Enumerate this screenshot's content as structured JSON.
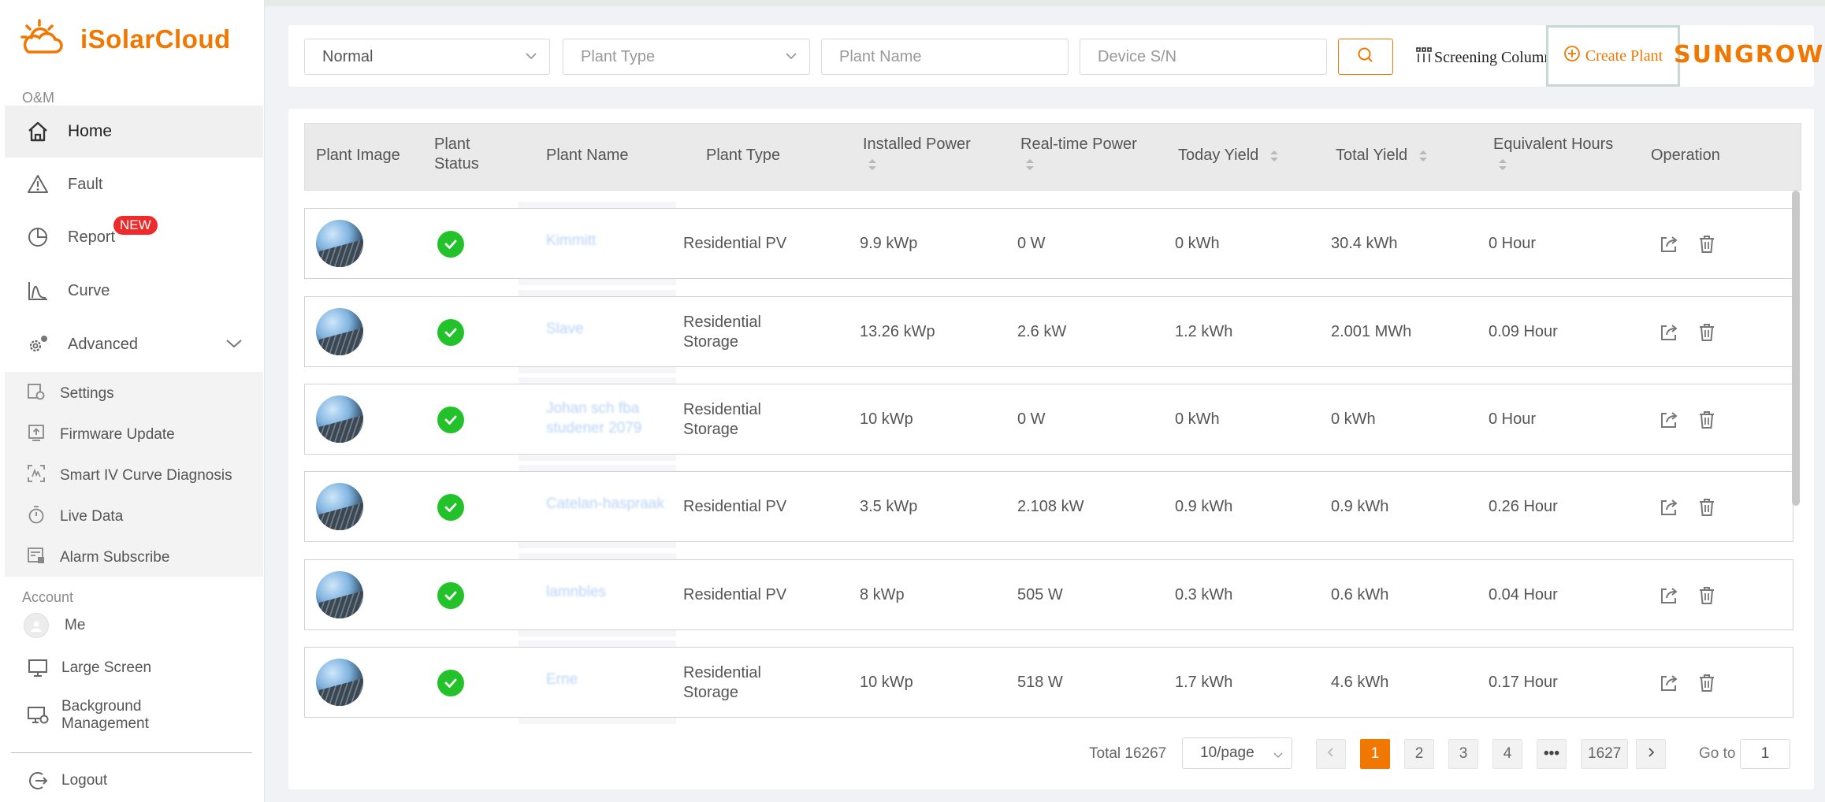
{
  "app": {
    "brand": "iSolarCloud",
    "partner_logo": "SUNGROW",
    "accent_color": "#f07800"
  },
  "sidebar": {
    "om_label": "O&M",
    "items": [
      {
        "label": "Home",
        "icon": "home-icon"
      },
      {
        "label": "Fault",
        "icon": "warning-icon"
      },
      {
        "label": "Report",
        "icon": "pie-chart-icon",
        "badge": "NEW"
      },
      {
        "label": "Curve",
        "icon": "curve-chart-icon"
      },
      {
        "label": "Advanced",
        "icon": "gear-icon"
      }
    ],
    "advanced_items": [
      {
        "label": "Settings",
        "icon": "settings-icon"
      },
      {
        "label": "Firmware Update",
        "icon": "upload-icon"
      },
      {
        "label": "Smart IV Curve Diagnosis",
        "icon": "scan-icon"
      },
      {
        "label": "Live Data",
        "icon": "stopwatch-icon"
      },
      {
        "label": "Alarm Subscribe",
        "icon": "alarm-list-icon"
      }
    ],
    "account_label": "Account",
    "account_items": [
      {
        "label": "Me",
        "icon": "avatar-icon"
      },
      {
        "label": "Large Screen",
        "icon": "monitor-icon"
      },
      {
        "label": "Background Management",
        "icon": "monitor-gear-icon"
      }
    ],
    "logout_label": "Logout"
  },
  "filters": {
    "status_value": "Normal",
    "plant_type_placeholder": "Plant Type",
    "plant_name_placeholder": "Plant Name",
    "device_sn_placeholder": "Device S/N",
    "screening_label": "Screening Column",
    "create_plant_label": "Create Plant"
  },
  "table": {
    "headers": {
      "plant_image": "Plant Image",
      "plant_status": "Plant Status",
      "plant_name": "Plant Name",
      "plant_type": "Plant Type",
      "installed_power": "Installed Power",
      "realtime_power": "Real-time Power",
      "today_yield": "Today Yield",
      "total_yield": "Total Yield",
      "equivalent_hours": "Equivalent Hours",
      "operation": "Operation"
    },
    "rows": [
      {
        "name": "Kimmitt",
        "type": "Residential PV",
        "installed": "9.9 kWp",
        "realtime": "0 W",
        "today": "0 kWh",
        "total": "30.4 kWh",
        "hours": "0 Hour"
      },
      {
        "name": "Slave",
        "type": "Residential Storage",
        "installed": "13.26 kWp",
        "realtime": "2.6 kW",
        "today": "1.2 kWh",
        "total": "2.001 MWh",
        "hours": "0.09 Hour"
      },
      {
        "name": "Johan sch fba studener 2079",
        "type": "Residential Storage",
        "installed": "10 kWp",
        "realtime": "0 W",
        "today": "0 kWh",
        "total": "0 kWh",
        "hours": "0 Hour"
      },
      {
        "name": "Catelan-haspraak",
        "type": "Residential PV",
        "installed": "3.5 kWp",
        "realtime": "2.108 kW",
        "today": "0.9 kWh",
        "total": "0.9 kWh",
        "hours": "0.26 Hour"
      },
      {
        "name": "lamnbles",
        "type": "Residential PV",
        "installed": "8 kWp",
        "realtime": "505 W",
        "today": "0.3 kWh",
        "total": "0.6 kWh",
        "hours": "0.04 Hour"
      },
      {
        "name": "Erne",
        "type": "Residential Storage",
        "installed": "10 kWp",
        "realtime": "518 W",
        "today": "1.7 kWh",
        "total": "4.6 kWh",
        "hours": "0.17 Hour"
      }
    ]
  },
  "pagination": {
    "total": "Total 16267",
    "page_size": "10/page",
    "prev": "<",
    "pages": [
      "1",
      "2",
      "3",
      "4",
      "•••",
      "1627"
    ],
    "next": ">",
    "goto_label": "Go to",
    "goto_value": "1"
  }
}
